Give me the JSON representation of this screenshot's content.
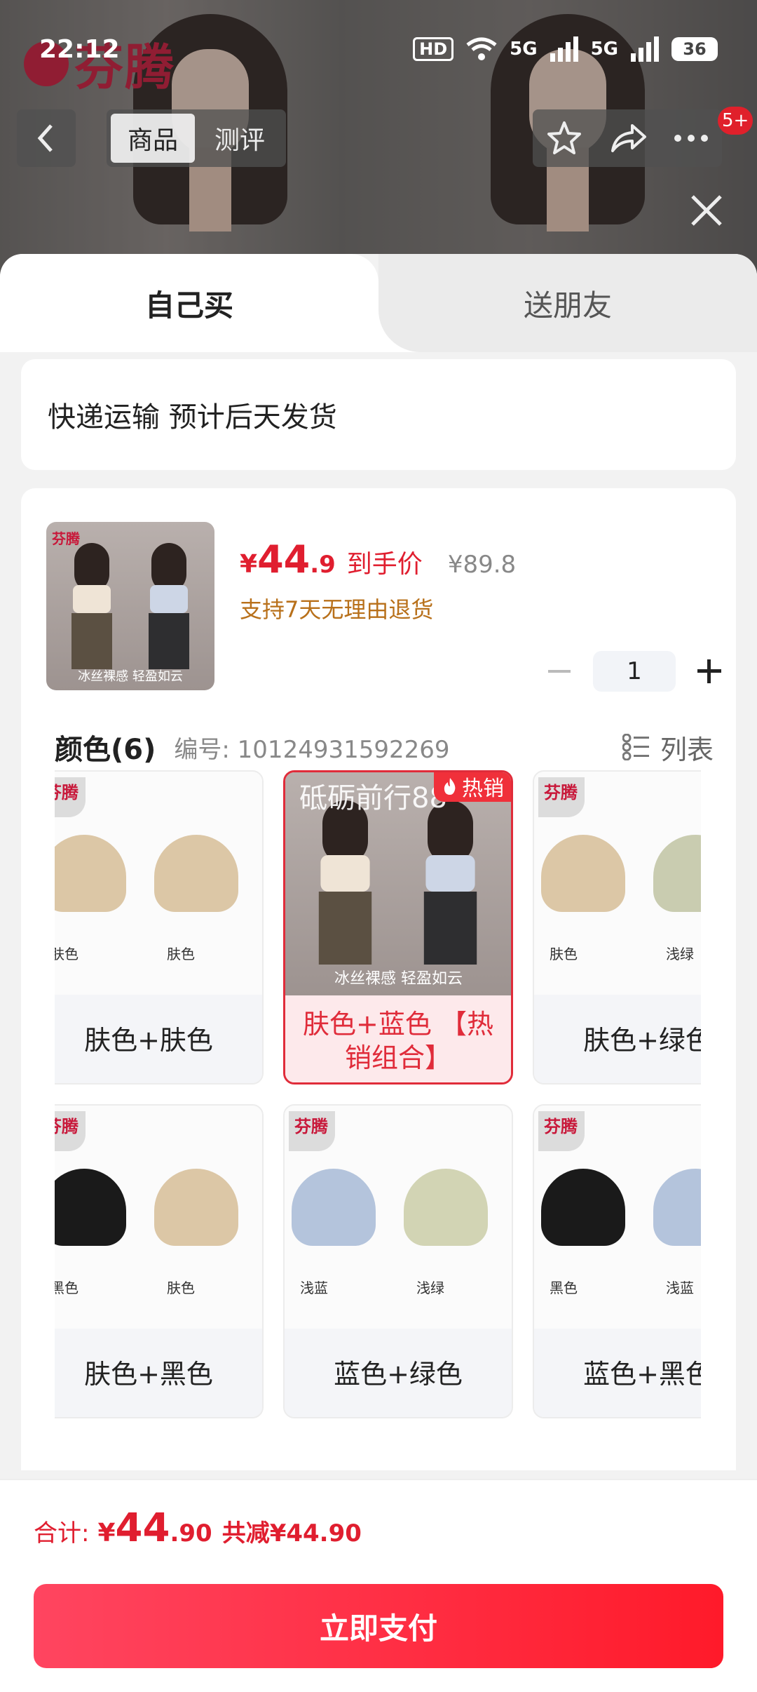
{
  "status_bar": {
    "time": "22:12",
    "hd": "HD",
    "signal1": "5G",
    "signal2": "5G",
    "battery": "36"
  },
  "brand": {
    "logo_text": "芬腾"
  },
  "nav": {
    "tabs": [
      {
        "label": "商品"
      },
      {
        "label": "测评"
      }
    ],
    "badge": "5+"
  },
  "mode_tabs": {
    "self": "自己买",
    "gift": "送朋友"
  },
  "shipping": {
    "text": "快递运输 预计后天发货"
  },
  "product": {
    "thumb_caption": "冰丝裸感 轻盈如云",
    "price_symbol": "¥",
    "price_int": "44",
    "price_dec": ".9",
    "price_tag": "到手价",
    "original_price": "¥89.8",
    "return_policy": "支持7天无理由退货",
    "quantity": "1"
  },
  "color_section": {
    "title": "颜色(6)",
    "sku_label": "编号: 10124931592269",
    "list_toggle": "列表",
    "options": [
      {
        "label": "肤色+肤色",
        "left_name": "肤色",
        "right_name": "肤色",
        "left_color": "#dcc7a6",
        "right_color": "#dcc7a6",
        "selected": false,
        "hot": ""
      },
      {
        "label": "肤色+蓝色 【热销组合】",
        "selected": true,
        "hot": "热销",
        "watermark": "砥砺前行88",
        "image_caption": "冰丝裸感 轻盈如云"
      },
      {
        "label": "肤色+绿色",
        "left_name": "肤色",
        "right_name": "浅绿",
        "left_color": "#dcc7a6",
        "right_color": "#c9ccb0",
        "selected": false,
        "hot": ""
      },
      {
        "label": "肤色+黑色",
        "left_name": "黑色",
        "right_name": "肤色",
        "left_color": "#1a1a1a",
        "right_color": "#dcc7a6",
        "selected": false,
        "hot": ""
      },
      {
        "label": "蓝色+绿色",
        "left_name": "浅蓝",
        "right_name": "浅绿",
        "left_color": "#b4c4dc",
        "right_color": "#d2d4b4",
        "selected": false,
        "hot": ""
      },
      {
        "label": "蓝色+黑色",
        "left_name": "黑色",
        "right_name": "浅蓝",
        "left_color": "#1a1a1a",
        "right_color": "#b4c4dc",
        "selected": false,
        "hot": ""
      }
    ],
    "option_logo": "芬腾"
  },
  "footer": {
    "total_label": "合计:",
    "total_symbol": "¥",
    "total_int": "44",
    "total_dec": ".90",
    "saved_text": "共减¥44.90",
    "pay_button": "立即支付"
  }
}
